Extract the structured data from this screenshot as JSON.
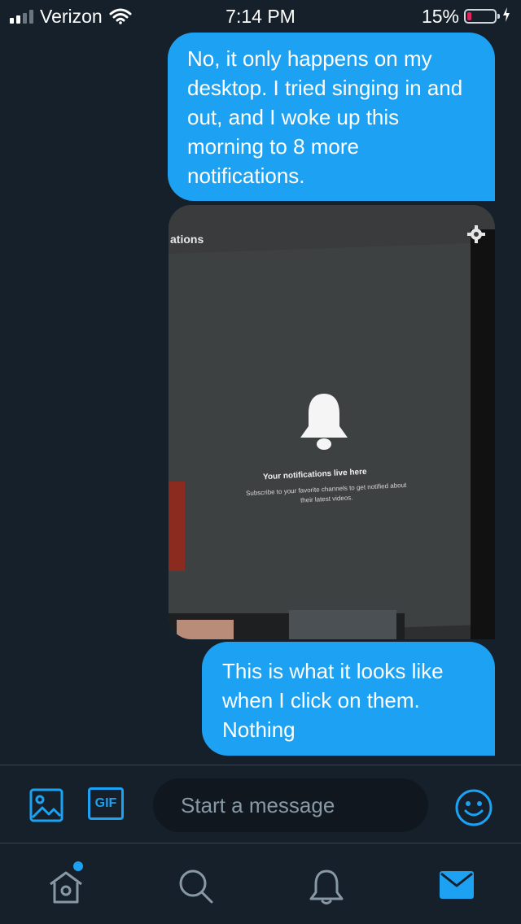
{
  "status_bar": {
    "carrier": "Verizon",
    "time": "7:14 PM",
    "battery_percent": "15%",
    "battery_level": 0.15,
    "signal_bars": 2
  },
  "messages": [
    {
      "text": "No, it only happens on my desktop. I tried singing in and out, and I woke up this morning to 8 more notifications."
    },
    {
      "text": "This is what it looks like when I click on them. Nothing"
    }
  ],
  "photo": {
    "header_fragment": "ations",
    "title": "Your notifications live here",
    "subtitle": "Subscribe to your favorite channels to get notified about their latest videos."
  },
  "composer": {
    "placeholder": "Start a message",
    "gif_label": "GIF"
  },
  "colors": {
    "background": "#15202b",
    "accent": "#1da1f2",
    "divider": "#38444d",
    "muted": "#8899a6"
  },
  "tabs": [
    {
      "name": "home-icon",
      "has_badge": true
    },
    {
      "name": "search-icon"
    },
    {
      "name": "bell-icon"
    },
    {
      "name": "envelope-icon",
      "active": true
    }
  ]
}
